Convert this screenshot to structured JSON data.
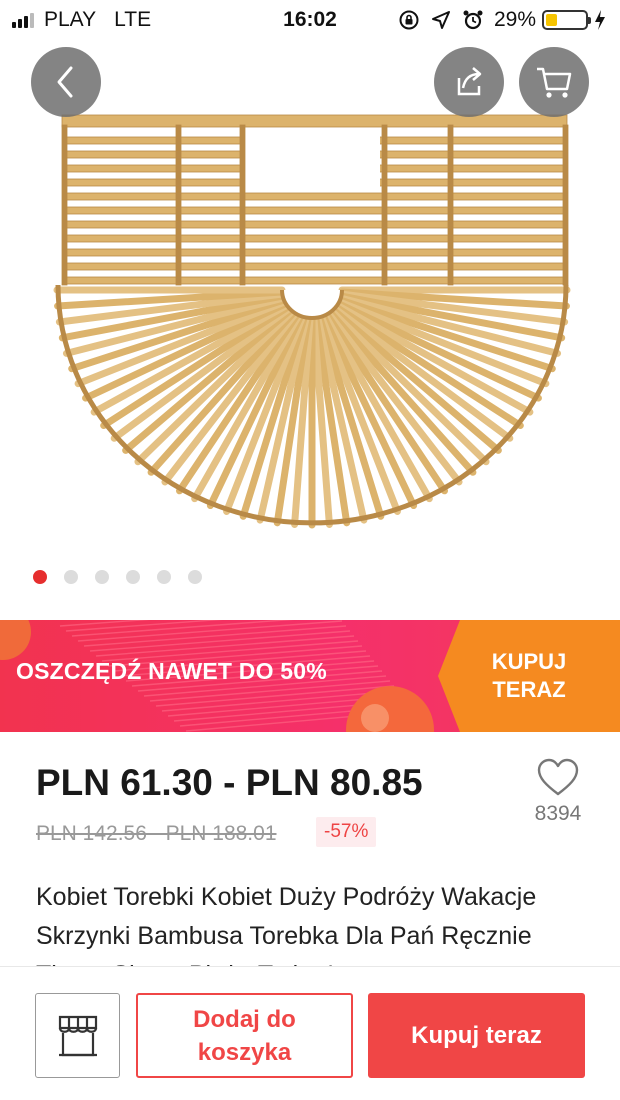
{
  "status_bar": {
    "carrier": "PLAY",
    "network": "LTE",
    "time": "16:02",
    "battery_percent": "29%",
    "battery_level": 0.29,
    "icons": [
      "signal-icon",
      "rotation-lock-icon",
      "location-icon",
      "alarm-icon",
      "battery-icon",
      "charging-icon"
    ]
  },
  "gallery": {
    "image_count": 6,
    "active_index": 0,
    "buttons": [
      "back-icon",
      "share-icon",
      "cart-icon"
    ]
  },
  "promo": {
    "text": "OSZCZĘDŹ NAWET DO 50%",
    "cta": "KUPUJ TERAZ"
  },
  "product": {
    "price": "PLN 61.30 - PLN 80.85",
    "original_price": "PLN 142.56 - PLN 188.01",
    "discount": "-57%",
    "wishlist_count": "8394",
    "title": "Kobiet Torebki Kobiet Duży Podróży Wakacje Skrzynki Bambusa Torebka Dla Pań Ręcznie Tkane Słomy Plaża Torba Lato"
  },
  "actions": {
    "add_to_cart": "Dodaj do koszyka",
    "buy_now": "Kupuj teraz"
  },
  "colors": {
    "accent": "#f04646",
    "promo_pink": "#f2334f",
    "promo_orange": "#f58a20",
    "bamboo": "#d9b26a"
  }
}
